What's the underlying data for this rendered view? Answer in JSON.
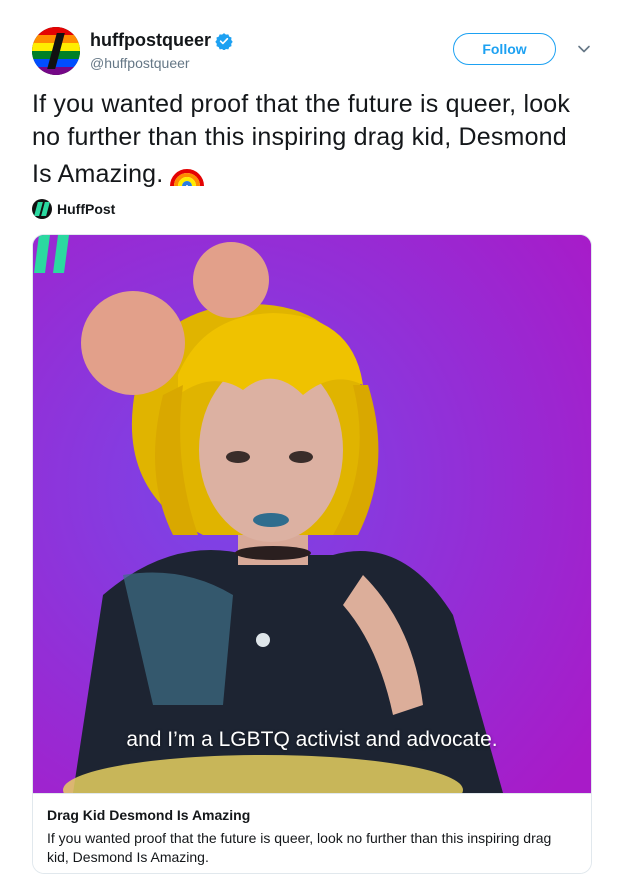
{
  "header": {
    "account_name": "huffpostqueer",
    "handle": "@huffpostqueer",
    "follow_label": "Follow"
  },
  "tweet": {
    "text": "If you wanted proof that the future is queer, look no further than this inspiring drag kid, Desmond Is Amazing."
  },
  "via": {
    "name": "HuffPost"
  },
  "card": {
    "caption": "and I’m a LGBTQ activist and advocate.",
    "title": "Drag Kid Desmond Is Amazing",
    "description": "If you wanted proof that the future is queer, look no further than this inspiring drag kid, Desmond Is Amazing."
  },
  "icons": {
    "verified": "verified-badge-icon",
    "more": "chevron-down-icon",
    "emoji": "rainbow-emoji"
  },
  "colors": {
    "accent": "#1da1f2",
    "brand_green": "#2bd9a0",
    "media_bg": "#9b2ed8"
  }
}
